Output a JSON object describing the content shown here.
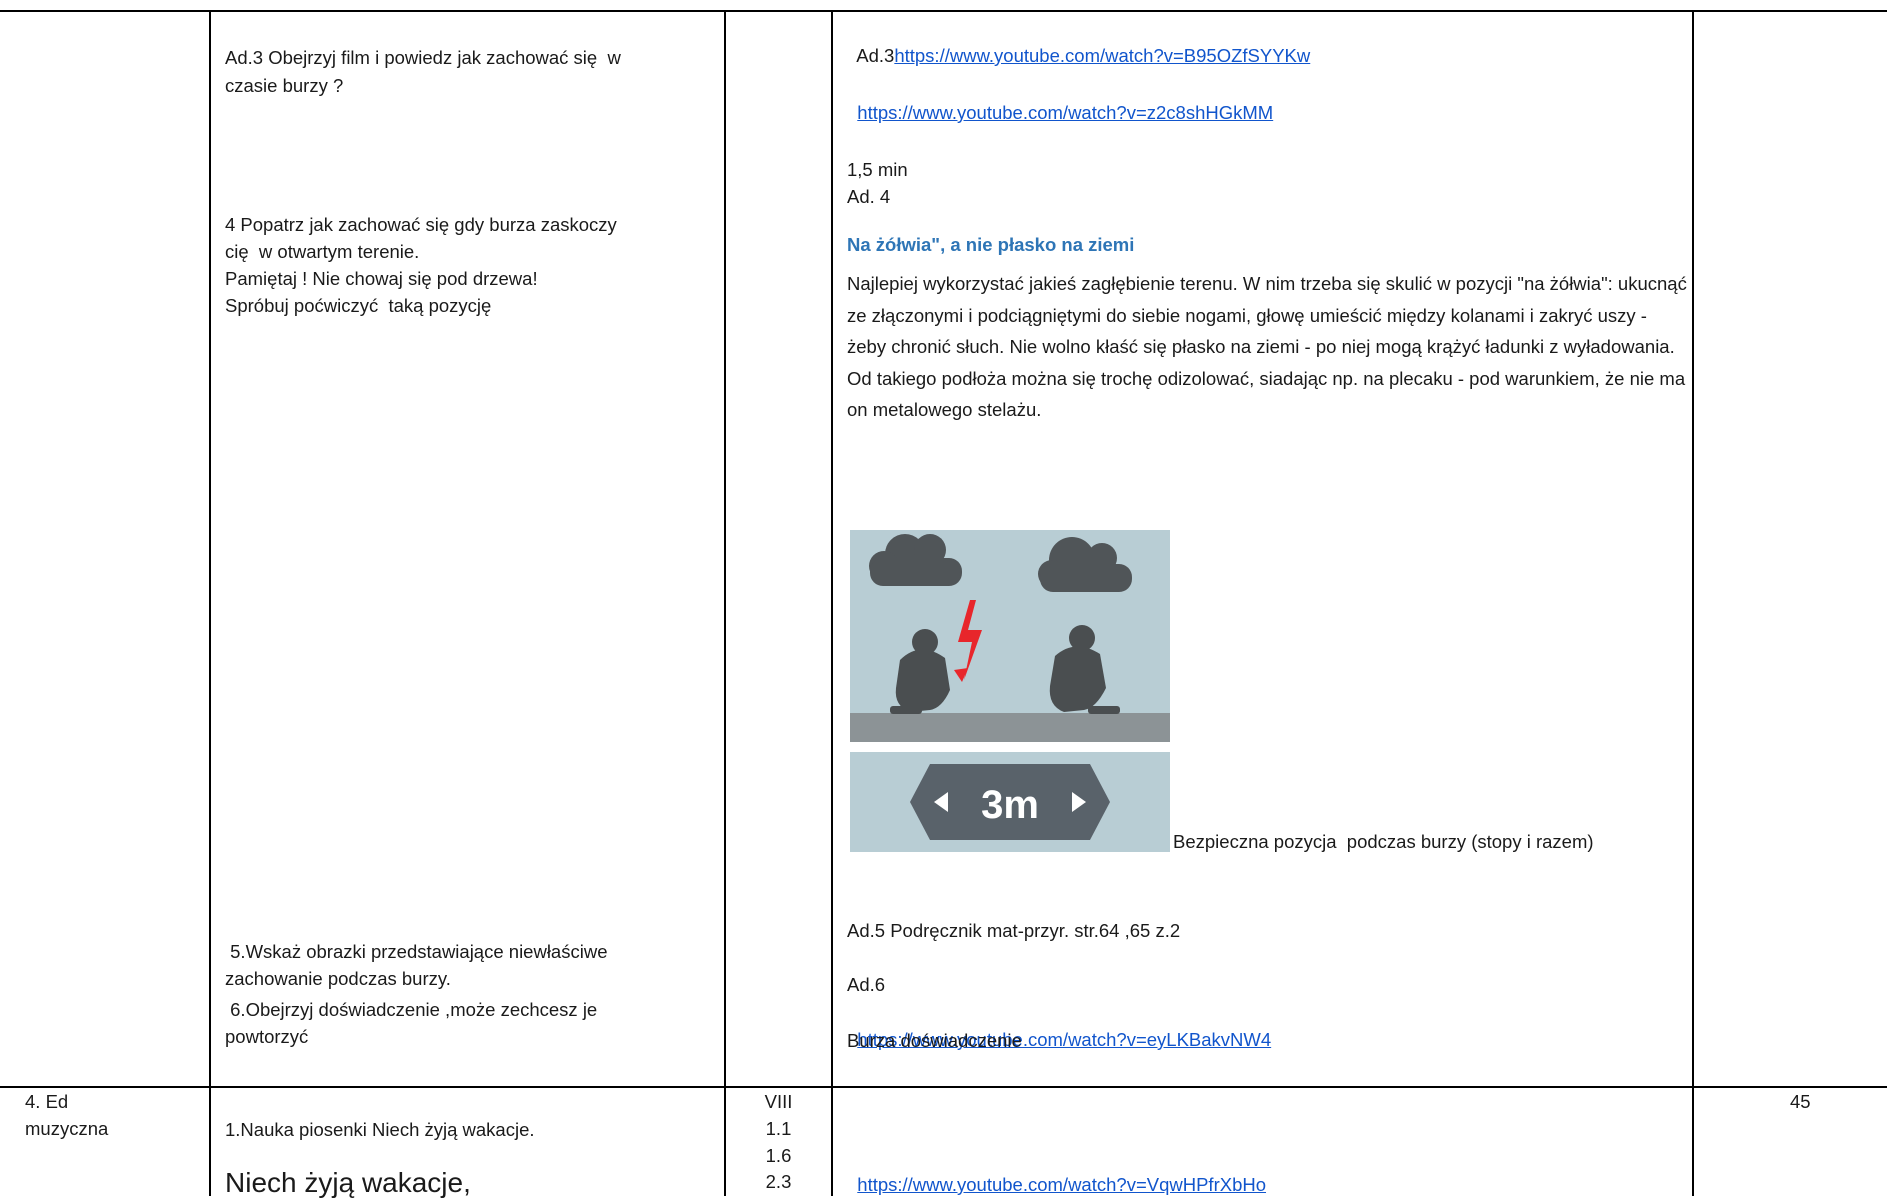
{
  "col_left": {
    "ad3": "Ad.3 Obejrzyj film i powiedz jak zachować się  w",
    "ad3_2": "czasie burzy ?",
    "p4_1": "4 Popatrz jak zachować się gdy burza zaskoczy",
    "p4_2": "cię  w otwartym terenie.",
    "p4_3": "Pamiętaj ! Nie chowaj się pod drzewa!",
    "p4_4": "Spróbuj poćwiczyć  taką pozycję",
    "p5_1": " 5.Wskaż obrazki przedstawiające niewłaściwe",
    "p5_2": "zachowanie podczas burzy.",
    "p6_1": " 6.Obejrzyj doświadczenie ,może zechcesz je",
    "p6_2": "powtorzyć"
  },
  "col_right": {
    "ad3_prefix": "Ad.3",
    "link1": "https://www.youtube.com/watch?v=B95OZfSYYKw",
    "link2": "https://www.youtube.com/watch?v=z2c8shHGkMM",
    "duration": "1,5 min",
    "ad4": "Ad. 4",
    "heading": "Na żółwia\", a nie płasko na ziemi",
    "paragraph": "Najlepiej wykorzystać jakieś zagłębienie terenu. W nim trzeba się skulić w pozycji \"na żółwia\": ukucnąć ze złączonymi i podciągniętymi do siebie nogami, głowę umieścić między kolanami i zakryć uszy - żeby chronić słuch. Nie wolno kłaść się płasko na ziemi - po niej mogą krążyć ładunki z wyładowania. Od takiego podłoża można się trochę odizolować, siadając np. na plecaku - pod warunkiem, że nie ma on metalowego stelażu.",
    "distance_label": "3m",
    "caption": "Bezpieczna pozycja  podczas burzy (stopy i razem)",
    "ad5": "Ad.5 Podręcznik mat-przyr. str.64 ,65 z.2",
    "ad6": "Ad.6",
    "link3": "https://www.youtube.com/watch?v=eyLKBakvNW4",
    "ad6_desc": "Burza doświadczenie"
  },
  "row2": {
    "subject_1": "4. Ed",
    "subject_2": "muzyczna",
    "task": "1.Nauka piosenki Niech żyją wakacje.",
    "song_title": "Niech żyją wakacje,",
    "codes": [
      "VIII",
      "1.1",
      "1.6",
      "2.3"
    ],
    "link": "https://www.youtube.com/watch?v=VqwHPfrXbHo",
    "time": "45"
  }
}
